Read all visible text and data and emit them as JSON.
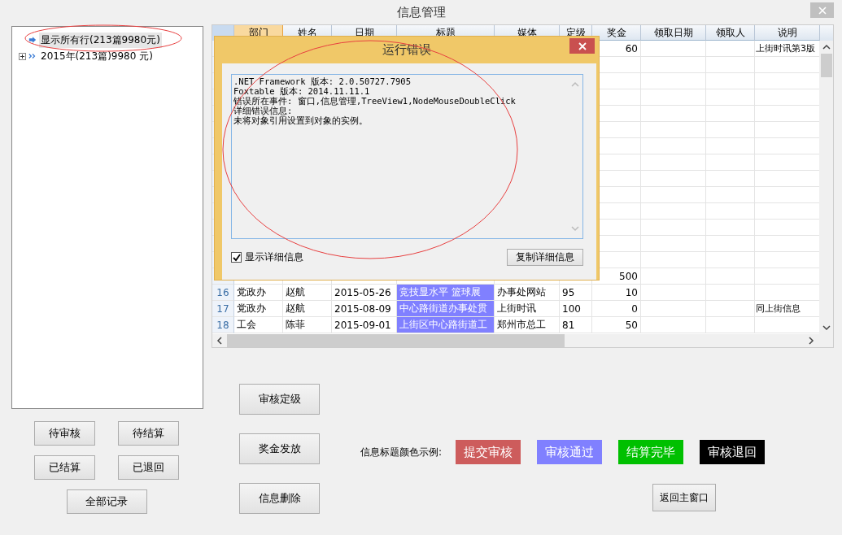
{
  "window": {
    "title": "信息管理"
  },
  "tree": [
    {
      "label": "显示所有行(213篇9980元)",
      "selected": true,
      "kind": "leaf"
    },
    {
      "label": "2015年(213篇)9980 元)",
      "selected": false,
      "kind": "group",
      "expanded": false
    }
  ],
  "filter_buttons": [
    "待审核",
    "待结算",
    "已结算",
    "已退回",
    "全部记录"
  ],
  "table": {
    "columns": [
      "部门",
      "姓名",
      "日期",
      "标题",
      "媒体",
      "定级",
      "奖金",
      "领取日期",
      "领取人",
      "说明"
    ],
    "rows": [
      {
        "bonus": "60",
        "note": "上街时讯第3版"
      },
      {},
      {},
      {},
      {},
      {},
      {},
      {},
      {},
      {},
      {},
      {},
      {},
      {},
      {
        "bonus": "500"
      },
      {
        "number": "16",
        "dept": "党政办",
        "name": "赵航",
        "date": "2015-05-26",
        "title": "竞技显水平 篮球展",
        "color": "#8080ff",
        "media": "办事处网站",
        "grade": "95",
        "bonus": "10"
      },
      {
        "number": "17",
        "dept": "党政办",
        "name": "赵航",
        "date": "2015-08-09",
        "title": "中心路街道办事处贯",
        "color": "#8080ff",
        "media": "上街时讯",
        "grade": "100",
        "bonus": "0",
        "note": "同上街信息"
      },
      {
        "number": "18",
        "dept": "工会",
        "name": "陈菲",
        "date": "2015-09-01",
        "title": "上街区中心路街道工",
        "color": "#8080ff",
        "media": "郑州市总工",
        "grade": "81",
        "bonus": "50"
      }
    ]
  },
  "action_buttons": [
    "审核定级",
    "奖金发放",
    "信息删除"
  ],
  "legend": {
    "label": "信息标题颜色示例:",
    "items": [
      {
        "label": "提交审核",
        "color": "#cd5c5c"
      },
      {
        "label": "审核通过",
        "color": "#8080ff"
      },
      {
        "label": "结算完毕",
        "color": "#00c000"
      },
      {
        "label": "审核退回",
        "color": "#000000"
      }
    ]
  },
  "return_button": "返回主窗口",
  "error_dialog": {
    "title": "运行错误",
    "details": [
      ".NET Framework 版本: 2.0.50727.7905",
      "Foxtable 版本: 2014.11.11.1",
      "错误所在事件: 窗口,信息管理,TreeView1,NodeMouseDoubleClick",
      "详细错误信息:",
      "未将对象引用设置到对象的实例。"
    ],
    "show_details": {
      "label": "显示详细信息",
      "checked": true
    },
    "copy_button": "复制详细信息"
  }
}
